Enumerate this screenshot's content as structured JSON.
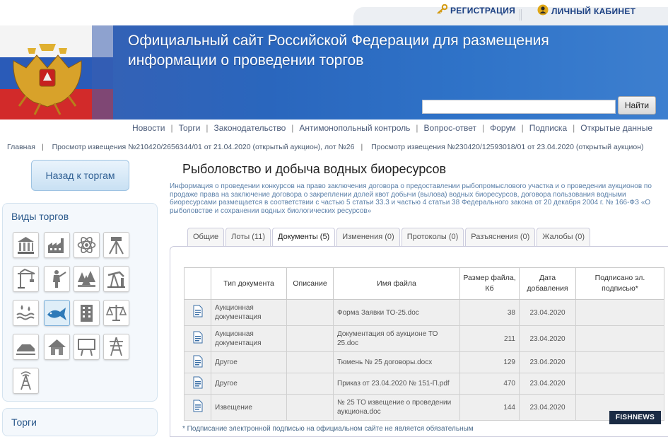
{
  "topbar": {
    "registration": "РЕГИСТРАЦИЯ",
    "cabinet": "ЛИЧНЫЙ КАБИНЕТ"
  },
  "banner": {
    "title_line1": "Официальный сайт Российской Федерации для размещения",
    "title_line2": "информации о проведении торгов",
    "search_button": "Найти"
  },
  "nav": [
    "Новости",
    "Торги",
    "Законодательство",
    "Антимонопольный контроль",
    "Вопрос-ответ",
    "Форум",
    "Подписка",
    "Открытые данные"
  ],
  "breadcrumbs": [
    "Главная",
    "Просмотр извещения №210420/2656344/01 от 21.04.2020 (открытый аукцион), лот №26",
    "Просмотр извещения №230420/12593018/01 от 23.04.2020 (открытый аукцион)"
  ],
  "sidebar": {
    "back_button": "Назад к торгам",
    "types_title": "Виды торгов",
    "trades_title": "Торги"
  },
  "main": {
    "title": "Рыболовство и добыча водных биоресурсов",
    "description": "Информация о проведении конкурсов на право заключения договора о предоставлении рыбопромыслового участка и о проведении аукционов по продаже права на заключение договора о закреплении долей квот добычи (вылова) водных биоресурсов, договора пользования водными биоресурсами размещается в соответствии с частью 5 статьи 33.3 и частью 4 статьи 38 Федерального закона от 20 декабря 2004 г. № 166-ФЗ «О рыболовстве и сохранении водных биологических ресурсов»",
    "tabs": [
      "Общие",
      "Лоты (11)",
      "Документы (5)",
      "Изменения (0)",
      "Протоколы (0)",
      "Разъяснения (0)",
      "Жалобы (0)"
    ],
    "active_tab": 2
  },
  "table": {
    "headers": [
      "Тип документа",
      "Описание",
      "Имя файла",
      "Размер файла, Кб",
      "Дата добавления",
      "Подписано эл. подписью*"
    ],
    "rows": [
      {
        "type": "Аукционная документация",
        "desc": "",
        "file": "Форма Заявки ТО-25.doc",
        "size": "38",
        "date": "23.04.2020",
        "signed": ""
      },
      {
        "type": "Аукционная документация",
        "desc": "",
        "file": "Документация об аукционе ТО 25.doc",
        "size": "211",
        "date": "23.04.2020",
        "signed": ""
      },
      {
        "type": "Другое",
        "desc": "",
        "file": "Тюмень № 25 договоры.docx",
        "size": "129",
        "date": "23.04.2020",
        "signed": ""
      },
      {
        "type": "Другое",
        "desc": "",
        "file": "Приказ от 23.04.2020 № 151-П.pdf",
        "size": "470",
        "date": "23.04.2020",
        "signed": ""
      },
      {
        "type": "Извещение",
        "desc": "",
        "file": "№ 25 ТО извещение о проведении аукциона.doc",
        "size": "144",
        "date": "23.04.2020",
        "signed": ""
      }
    ]
  },
  "footnote": "* Подписание электронной подписью на официальном сайте не является обязательным",
  "watermark": "FISHNEWS",
  "colors": {
    "banner": "#2a66bd",
    "link": "#1a3f82",
    "accent": "#2c5a8c"
  }
}
